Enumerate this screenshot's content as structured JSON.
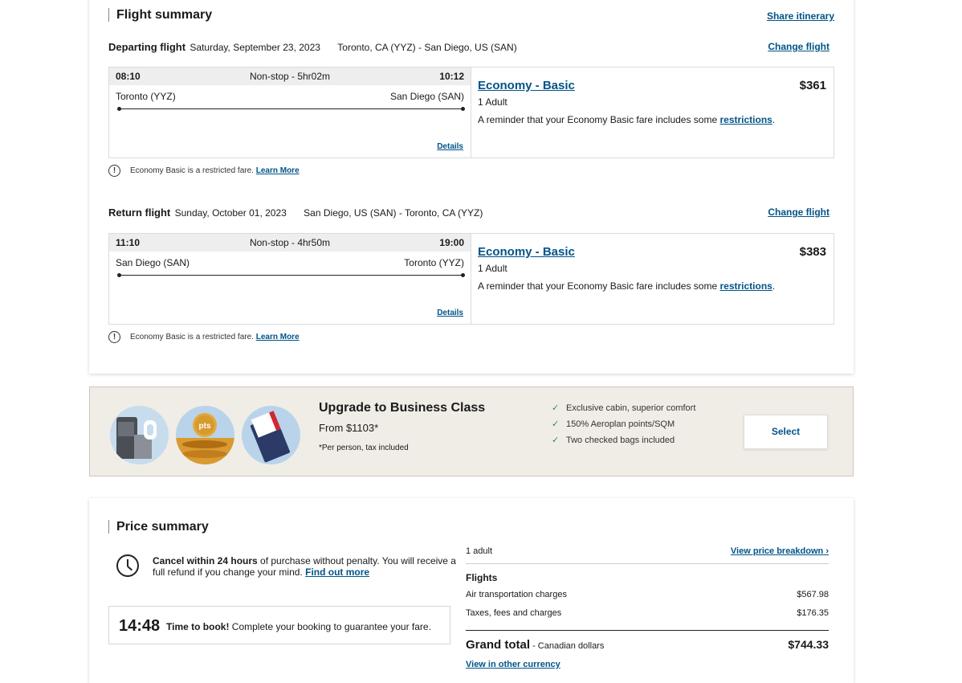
{
  "flight_summary": {
    "title": "Flight summary",
    "share_label": "Share itinerary",
    "departing": {
      "kind": "Departing flight",
      "date": "Saturday, September 23, 2023",
      "route": "Toronto, CA (YYZ) - San Diego, US (SAN)",
      "change_label": "Change flight",
      "dep_time": "08:10",
      "duration": "Non-stop - 5hr02m",
      "arr_time": "10:12",
      "origin": "Toronto (YYZ)",
      "destination": "San Diego (SAN)",
      "details_label": "Details",
      "fare": "Economy - Basic",
      "price": "$361",
      "pax": "1 Adult",
      "reminder": "A reminder that your Economy Basic fare includes some ",
      "restrictions_label": "restrictions",
      "period": ".",
      "restrict_note": "Economy Basic is a restricted fare.",
      "learn_more": "Learn More"
    },
    "return": {
      "kind": "Return flight",
      "date": "Sunday, October 01, 2023",
      "route": "San Diego, US (SAN) - Toronto, CA (YYZ)",
      "change_label": "Change flight",
      "dep_time": "11:10",
      "duration": "Non-stop - 4hr50m",
      "arr_time": "19:00",
      "origin": "San Diego (SAN)",
      "destination": "Toronto (YYZ)",
      "details_label": "Details",
      "fare": "Economy - Basic",
      "price": "$383",
      "pax": "1 Adult",
      "reminder": "A reminder that your Economy Basic fare includes some ",
      "restrictions_label": "restrictions",
      "period": ".",
      "restrict_note": "Economy Basic is a restricted fare.",
      "learn_more": "Learn More"
    }
  },
  "upgrade": {
    "title": "Upgrade to Business Class",
    "from": "From $1103*",
    "note": "*Per person, tax included",
    "perks": [
      "Exclusive cabin, superior comfort",
      "150% Aeroplan points/SQM",
      "Two checked bags included"
    ],
    "select_label": "Select",
    "icons": [
      "business-seat-icon",
      "points-coin-icon",
      "boarding-pass-icon"
    ],
    "pts_label": "pts"
  },
  "price_summary": {
    "title": "Price summary",
    "cancel_bold": "Cancel within 24 hours",
    "cancel_text": " of purchase without penalty. You will receive a full refund if you change your mind. ",
    "find_out": "Find out more",
    "timer": "14:48",
    "timer_bold": "Time to book!",
    "timer_text": " Complete your booking to guarantee your fare.",
    "pax": "1 adult",
    "breakdown_label": "View price breakdown",
    "flights_label": "Flights",
    "air_label": "Air transportation charges",
    "air_value": "$567.98",
    "tax_label": "Taxes, fees and charges",
    "tax_value": "$176.35",
    "grand_label": "Grand total",
    "currency": " - Canadian dollars",
    "grand_value": "$744.33",
    "other_currency": "View in other currency"
  },
  "colors": {
    "link": "#005487",
    "banner": "#f0ede6",
    "check": "#2e8b3d"
  }
}
